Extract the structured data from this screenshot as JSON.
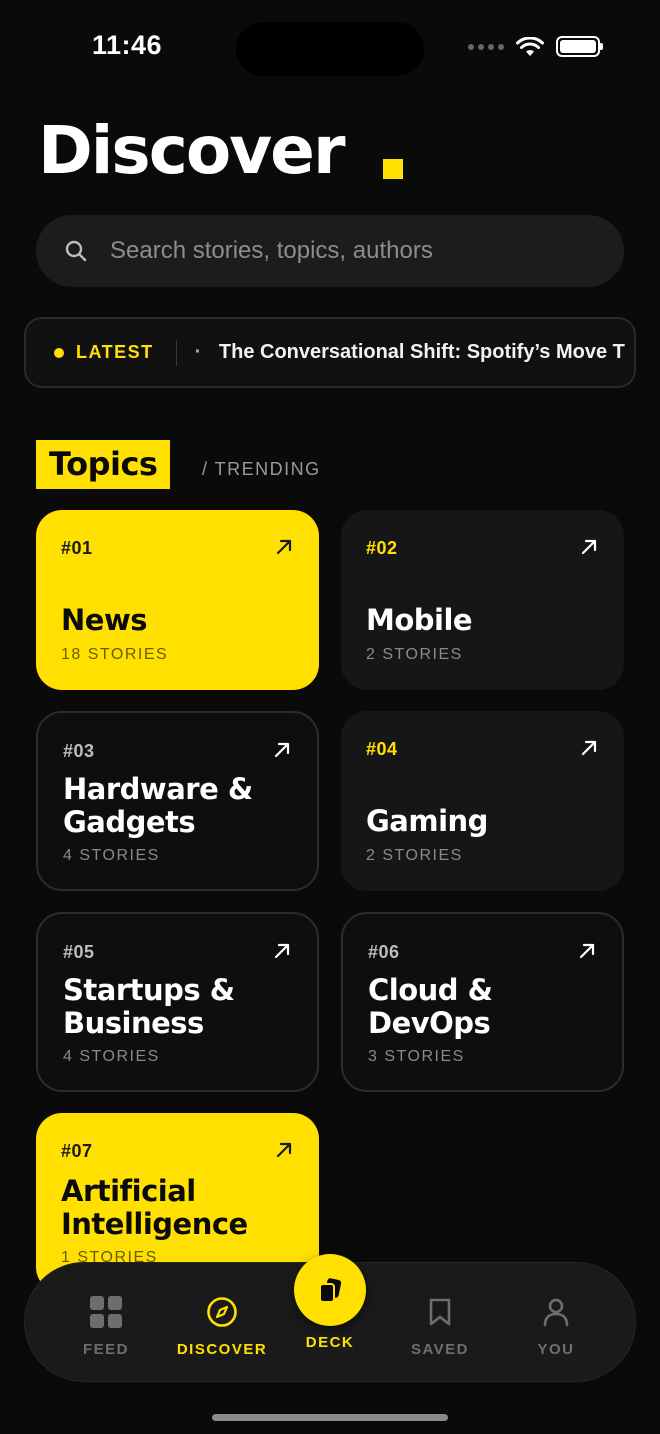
{
  "status": {
    "time": "11:46"
  },
  "header": {
    "title": "Discover"
  },
  "search": {
    "placeholder": "Search stories, topics, authors"
  },
  "ticker": {
    "label": "LATEST",
    "headline": "The Conversational Shift: Spotify’s Move T"
  },
  "section": {
    "title": "Topics",
    "subtitle": "/ TRENDING"
  },
  "topics": [
    {
      "num": "#01",
      "name": "News",
      "count": "18 STORIES"
    },
    {
      "num": "#02",
      "name": "Mobile",
      "count": "2 STORIES"
    },
    {
      "num": "#03",
      "name": "Hardware & Gadgets",
      "count": "4 STORIES"
    },
    {
      "num": "#04",
      "name": "Gaming",
      "count": "2 STORIES"
    },
    {
      "num": "#05",
      "name": "Startups & Business",
      "count": "4 STORIES"
    },
    {
      "num": "#06",
      "name": "Cloud & DevOps",
      "count": "3 STORIES"
    },
    {
      "num": "#07",
      "name": "Artificial Intelligence",
      "count": "1 STORIES"
    }
  ],
  "nav": {
    "feed": "FEED",
    "discover": "DISCOVER",
    "deck": "DECK",
    "saved": "SAVED",
    "you": "YOU"
  },
  "colors": {
    "accent": "#FFE000",
    "background": "#0a0a0a",
    "card": "#161616"
  }
}
